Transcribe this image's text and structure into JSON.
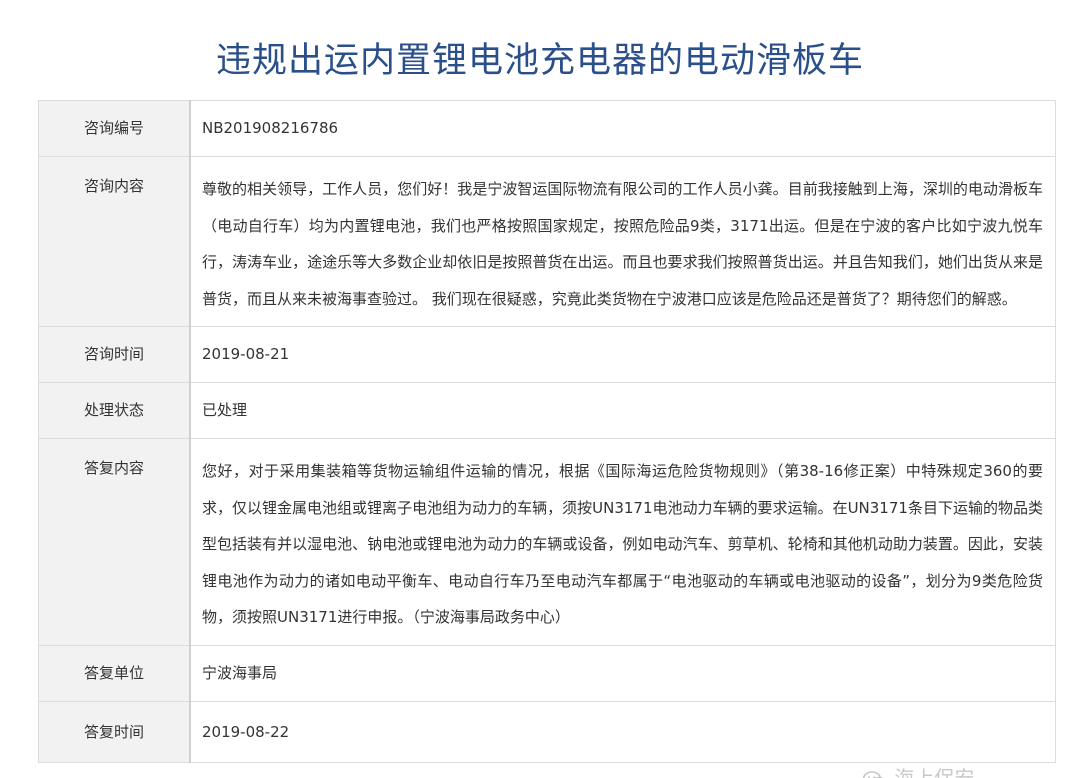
{
  "document": {
    "title": "违规出运内置锂电池充电器的电动滑板车",
    "rows": [
      {
        "label": "咨询编号",
        "value": "NB201908216786"
      },
      {
        "label": "咨询内容",
        "value": "尊敬的相关领导，工作人员，您们好！我是宁波智运国际物流有限公司的工作人员小龚。目前我接触到上海，深圳的电动滑板车（电动自行车）均为内置锂电池，我们也严格按照国家规定，按照危险品9类，3171出运。但是在宁波的客户比如宁波九悦车行，涛涛车业，途途乐等大多数企业却依旧是按照普货在出运。而且也要求我们按照普货出运。并且告知我们，她们出货从来是普货，而且从来未被海事查验过。 我们现在很疑惑，究竟此类货物在宁波港口应该是危险品还是普货了？期待您们的解惑。"
      },
      {
        "label": "咨询时间",
        "value": "2019-08-21"
      },
      {
        "label": "处理状态",
        "value": "已处理"
      },
      {
        "label": "答复内容",
        "value": "您好，对于采用集装箱等货物运输组件运输的情况，根据《国际海运危险货物规则》（第38-16修正案）中特殊规定360的要求，仅以锂金属电池组或锂离子电池组为动力的车辆，须按UN3171电池动力车辆的要求运输。在UN3171条目下运输的物品类型包括装有并以湿电池、钠电池或锂电池为动力的车辆或设备，例如电动汽车、剪草机、轮椅和其他机动助力装置。因此，安装锂电池作为动力的诸如电动平衡车、电动自行车乃至电动汽车都属于“电池驱动的车辆或电池驱动的设备”，划分为9类危险货物，须按照UN3171进行申报。（宁波海事局政务中心）"
      },
      {
        "label": "答复单位",
        "value": "宁波海事局"
      },
      {
        "label": "答复时间",
        "value": "2019-08-22"
      }
    ]
  },
  "watermark": {
    "text": "海上保安",
    "icon": "wechat-icon"
  },
  "colors": {
    "title": "#2a4f8a",
    "label_background": "#f2f2f2",
    "border": "#dcdcdc"
  }
}
